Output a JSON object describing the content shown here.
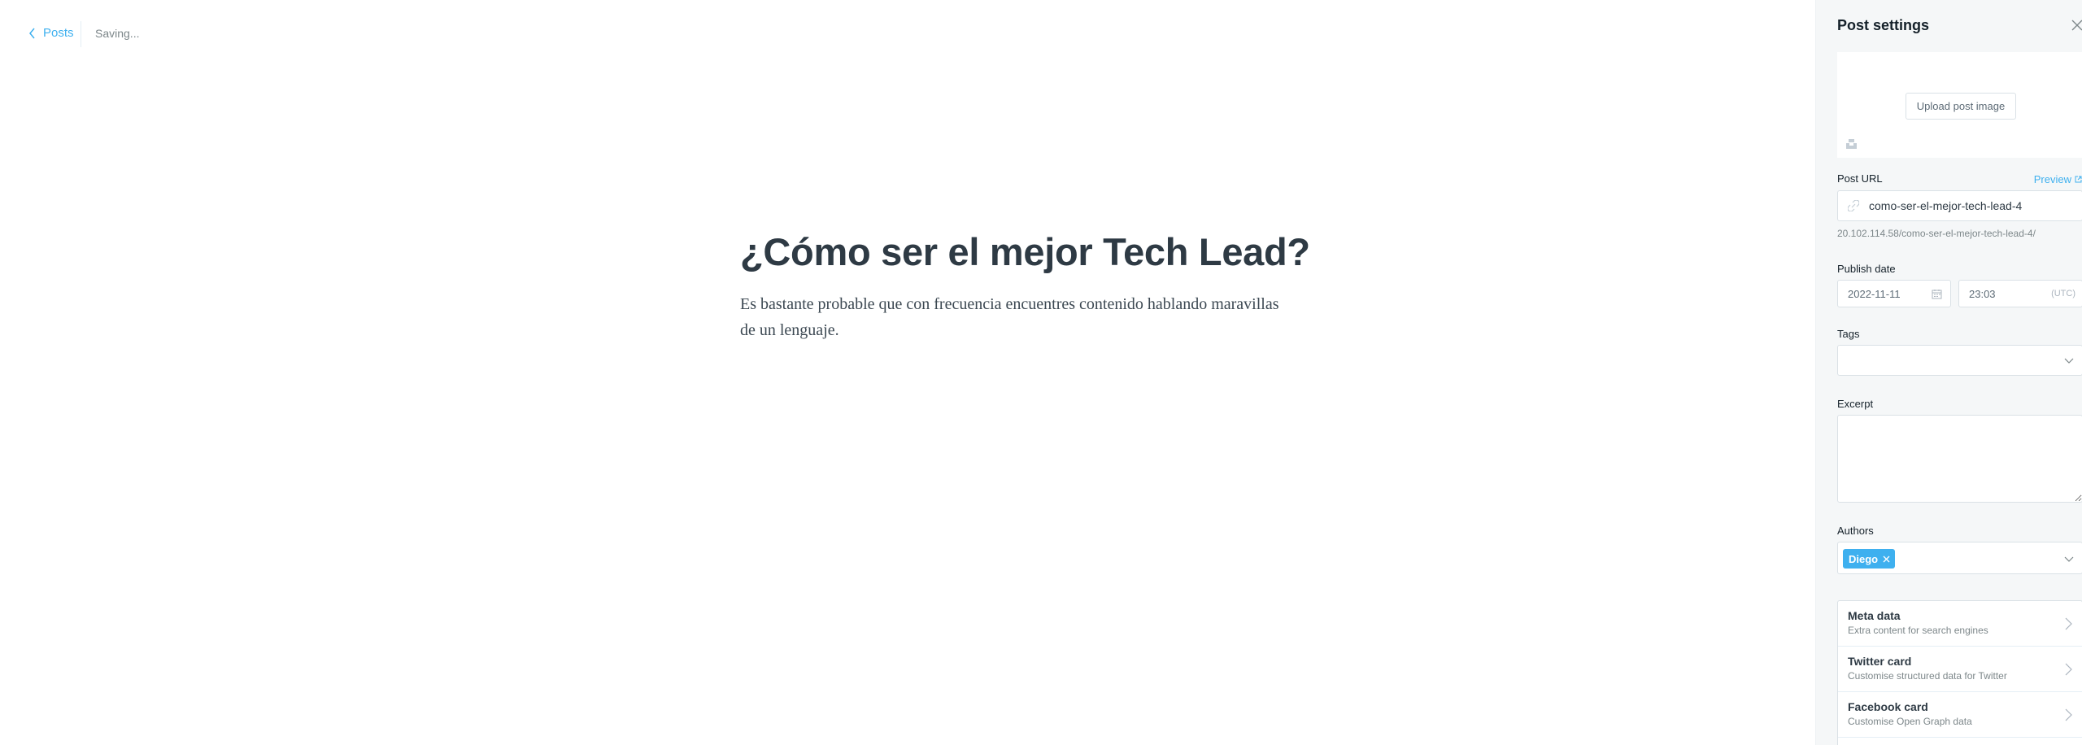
{
  "header": {
    "back_label": "Posts",
    "status": "Saving..."
  },
  "editor": {
    "title": "¿Cómo ser el mejor Tech Lead?",
    "body": "Es bastante probable que con frecuencia encuentres contenido hablando maravillas de un lenguaje."
  },
  "settings": {
    "title": "Post settings",
    "upload_label": "Upload post image",
    "post_url": {
      "label": "Post URL",
      "preview_label": "Preview",
      "value": "como-ser-el-mejor-tech-lead-4",
      "full_url": "20.102.114.58/como-ser-el-mejor-tech-lead-4/"
    },
    "publish_date": {
      "label": "Publish date",
      "date": "2022-11-11",
      "time": "23:03",
      "timezone": "(UTC)"
    },
    "tags": {
      "label": "Tags"
    },
    "excerpt": {
      "label": "Excerpt",
      "value": ""
    },
    "authors": {
      "label": "Authors",
      "selected": [
        "Diego"
      ]
    },
    "sections": [
      {
        "title": "Meta data",
        "subtitle": "Extra content for search engines"
      },
      {
        "title": "Twitter card",
        "subtitle": "Customise structured data for Twitter"
      },
      {
        "title": "Facebook card",
        "subtitle": "Customise Open Graph data"
      }
    ]
  },
  "colors": {
    "accent": "#3eb0ef",
    "panel_bg": "#f5f7f8",
    "text": "#15212a",
    "muted": "#7d878a"
  },
  "icons": [
    "chevron-left-icon",
    "close-icon",
    "unsplash-icon",
    "external-link-icon",
    "link-icon",
    "calendar-icon",
    "chevron-down-icon",
    "chevron-right-icon"
  ]
}
